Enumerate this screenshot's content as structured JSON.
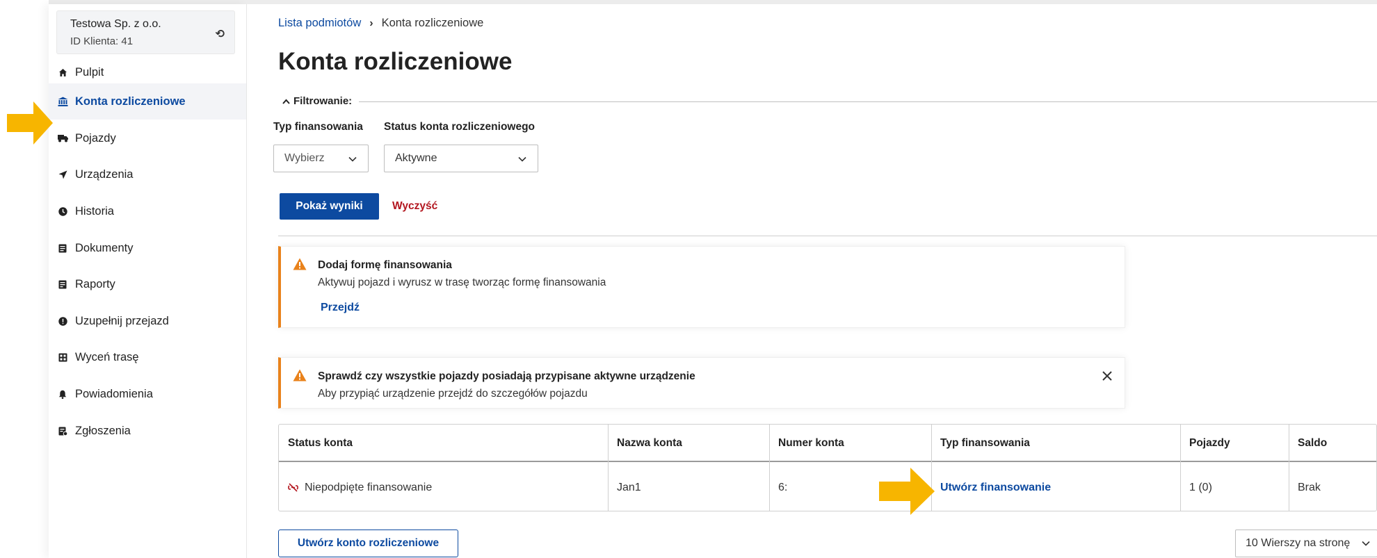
{
  "client": {
    "name": "Testowa Sp. z o.o.",
    "id_label": "ID Klienta: 41"
  },
  "sidebar": {
    "items": [
      {
        "label": "Pulpit",
        "icon": "home-icon"
      },
      {
        "label": "Konta rozliczeniowe",
        "icon": "bank-icon",
        "active": true
      },
      {
        "label": "Pojazdy",
        "icon": "truck-icon"
      },
      {
        "label": "Urządzenia",
        "icon": "navigation-arrow-icon"
      },
      {
        "label": "Historia",
        "icon": "clock-icon"
      },
      {
        "label": "Dokumenty",
        "icon": "document-icon"
      },
      {
        "label": "Raporty",
        "icon": "report-icon"
      },
      {
        "label": "Uzupełnij przejazd",
        "icon": "alert-circle-icon"
      },
      {
        "label": "Wyceń trasę",
        "icon": "calculator-icon"
      },
      {
        "label": "Powiadomienia",
        "icon": "bell-icon"
      },
      {
        "label": "Zgłoszenia",
        "icon": "ticket-icon"
      }
    ]
  },
  "breadcrumb": {
    "parent": "Lista podmiotów",
    "current": "Konta rozliczeniowe"
  },
  "page": {
    "title": "Konta rozliczeniowe"
  },
  "filters": {
    "legend": "Filtrowanie:",
    "type_label": "Typ finansowania",
    "type_value": "Wybierz",
    "status_label": "Status konta rozliczeniowego",
    "status_value": "Aktywne",
    "show_button": "Pokaż wyniki",
    "clear_button": "Wyczyść"
  },
  "alerts": [
    {
      "title": "Dodaj formę finansowania",
      "text": "Aktywuj pojazd i wyrusz w trasę tworząc formę finansowania",
      "link": "Przejdź"
    },
    {
      "title": "Sprawdź czy wszystkie pojazdy posiadają przypisane aktywne urządzenie",
      "text": "Aby przypiąć urządzenie przejdź do szczegółów pojazdu"
    }
  ],
  "table": {
    "headers": [
      "Status konta",
      "Nazwa konta",
      "Numer konta",
      "Typ finansowania",
      "Pojazdy",
      "Saldo"
    ],
    "row": {
      "status": "Niepodpięte finansowanie",
      "name": "Jan1",
      "number": "6:",
      "financing": "Utwórz finansowanie",
      "vehicles": "1 (0)",
      "balance": "Brak"
    }
  },
  "footer": {
    "create_button": "Utwórz konto rozliczeniowe",
    "rows_per_page": "10 Wierszy na stronę"
  },
  "colors": {
    "accent": "#0d4aa0",
    "warning": "#e9821b",
    "danger": "#b3161f",
    "arrow": "#f7b500"
  }
}
